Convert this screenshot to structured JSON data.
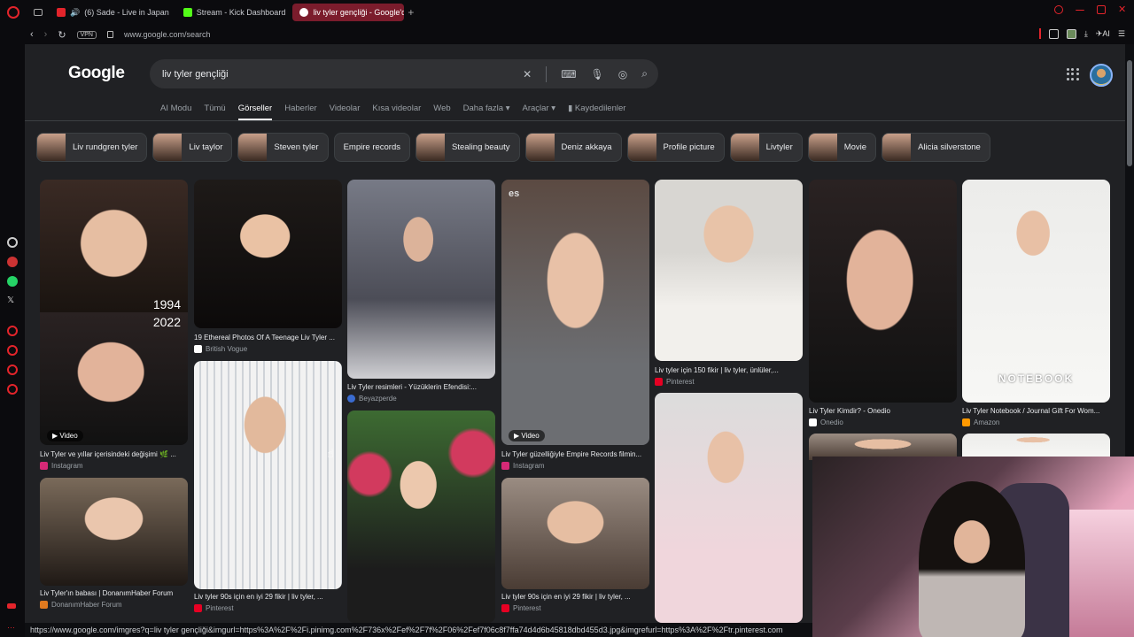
{
  "browser": {
    "tabs": [
      {
        "label": "(6) Sade - Live in Japan",
        "favicon": "youtube-icon"
      },
      {
        "label": "Stream - Kick Dashboard",
        "favicon": "kick-icon"
      },
      {
        "label": "liv tyler gençliği - Google'da",
        "favicon": "google-icon",
        "active": true
      }
    ],
    "new_tab": "+",
    "address": "www.google.com/search",
    "vpn_label": "VPN",
    "ai_label": "AI"
  },
  "google": {
    "logo": "Google",
    "query": "liv tyler gençliği",
    "nav_tabs": [
      "AI Modu",
      "Tümü",
      "Görseller",
      "Haberler",
      "Videolar",
      "Kısa videolar",
      "Web",
      "Daha fazla ▾",
      "Araçlar ▾",
      "Kaydedilenler"
    ],
    "active_tab": "Görseller",
    "chips": [
      "Liv rundgren tyler",
      "Liv taylor",
      "Steven tyler",
      "Empire records",
      "Stealing beauty",
      "Deniz akkaya",
      "Profile picture",
      "Livtyler",
      "Movie",
      "Alicia silverstone"
    ]
  },
  "results": [
    {
      "caption": "Liv Tyler ve yıllar içerisindeki değişimi 🌿 ...",
      "source": "Instagram",
      "badge": "Video",
      "year_top": "1994",
      "year_bottom": "2022"
    },
    {
      "caption": "19 Ethereal Photos Of A Teenage Liv Tyler ...",
      "source": "British Vogue"
    },
    {
      "caption": "Liv tyler 90s için en iyi 29 fikir | liv tyler, ...",
      "source": "Pinterest"
    },
    {
      "caption": "Liv Tyler resimleri - Yüzüklerin Efendisi:...",
      "source": "Beyazperde"
    },
    {
      "caption": "Liv Tyler güzelliğiyle Empire Records filmin...",
      "source": "Instagram",
      "badge": "Video",
      "corner": "es"
    },
    {
      "caption": "Liv tyler 90s için en iyi 29 fikir | liv tyler, ...",
      "source": "Pinterest"
    },
    {
      "caption": "Liv tyler için 150 fikir | liv tyler, ünlüler,...",
      "source": "Pinterest"
    },
    {
      "caption": "Liv Tyler Kimdir? - Onedio",
      "source": "Onedio"
    },
    {
      "caption": "Liv Tyler Notebook / Journal Gift For Wom...",
      "source": "Amazon",
      "overlay": "NOTEBOOK"
    },
    {
      "caption": "Liv Tyler'ın babası | DonanımHaber Forum",
      "source": "DonanımHaber Forum"
    }
  ],
  "status_url": "https://www.google.com/imgres?q=liv tyler gençliği&imgurl=https%3A%2F%2Fi.pinimg.com%2F736x%2Fef%2F7f%2F06%2Fef7f06c8f7ffa74d4d6b45818dbd455d3.jpg&imgrefurl=https%3A%2F%2Ftr.pinterest.com",
  "colors": {
    "accent": "#e3242b",
    "page_bg": "#202124",
    "search_bg": "#303134",
    "link_blue": "#8ab4f8"
  }
}
